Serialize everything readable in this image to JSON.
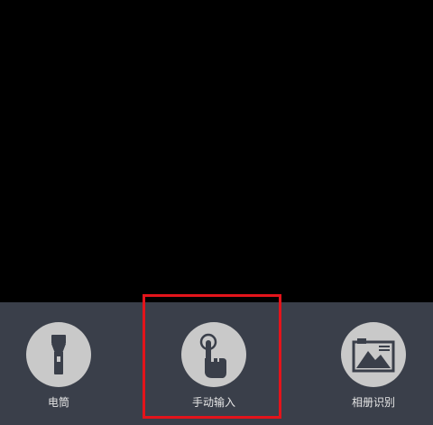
{
  "toolbar": {
    "items": [
      {
        "label": "电筒",
        "icon": "flashlight-icon"
      },
      {
        "label": "手动输入",
        "icon": "hand-tap-icon"
      },
      {
        "label": "相册识别",
        "icon": "photo-album-icon"
      }
    ]
  },
  "colors": {
    "toolbar_bg": "#3a3f4a",
    "icon_circle": "#c9c9c9",
    "highlight": "#e3141b"
  }
}
